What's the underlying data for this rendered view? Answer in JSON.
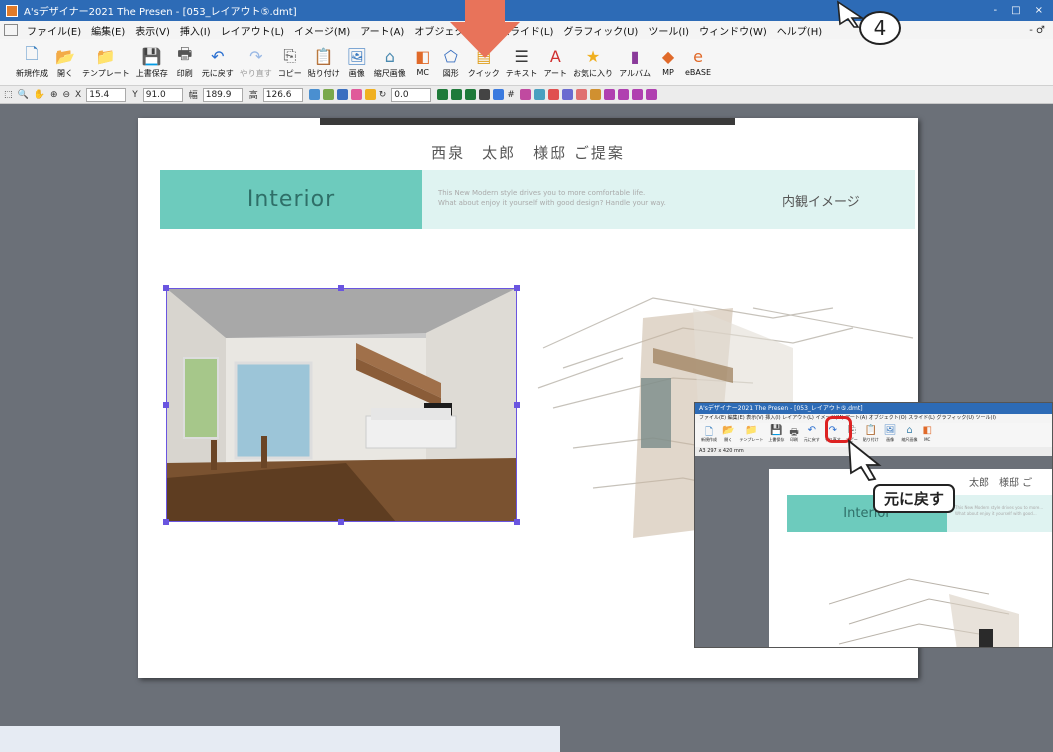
{
  "window": {
    "title": "A'sデザイナー2021 The Presen - [053_レイアウト⑤.dmt]",
    "controls": [
      "-",
      "□",
      "×"
    ]
  },
  "menu": {
    "items": [
      "ファイル(E)",
      "編集(E)",
      "表示(V)",
      "挿入(I)",
      "レイアウト(L)",
      "イメージ(M)",
      "アート(A)",
      "オブジェクト(O)",
      "スライド(L)",
      "グラフィック(U)",
      "ツール(I)",
      "ウィンドウ(W)",
      "ヘルプ(H)"
    ],
    "mdi": "- ♂"
  },
  "toolbar": {
    "buttons": [
      {
        "label": "新規作成",
        "icon": "new-doc-icon",
        "glyph": "🗋",
        "disabled": false
      },
      {
        "label": "開く",
        "icon": "open-folder-icon",
        "glyph": "📂",
        "disabled": false
      },
      {
        "label": "テンプレート",
        "icon": "template-icon",
        "glyph": "📁",
        "disabled": false
      },
      {
        "label": "上書保存",
        "icon": "save-icon",
        "glyph": "💾",
        "disabled": false
      },
      {
        "label": "印刷",
        "icon": "print-icon",
        "glyph": "🖶",
        "disabled": false
      },
      {
        "label": "元に戻す",
        "icon": "undo-icon",
        "glyph": "↶",
        "disabled": false
      },
      {
        "label": "やり直す",
        "icon": "redo-icon",
        "glyph": "↷",
        "disabled": true
      },
      {
        "label": "コピー",
        "icon": "copy-icon",
        "glyph": "⎘",
        "disabled": false
      },
      {
        "label": "貼り付け",
        "icon": "paste-icon",
        "glyph": "📋",
        "disabled": false
      },
      {
        "label": "画像",
        "icon": "image-icon",
        "glyph": "🖼",
        "disabled": false
      },
      {
        "label": "縮尺画像",
        "icon": "scaled-image-icon",
        "glyph": "⌂",
        "disabled": false
      },
      {
        "label": "MC",
        "icon": "mc-icon",
        "glyph": "◧",
        "disabled": false
      },
      {
        "label": "図形",
        "icon": "shape-icon",
        "glyph": "⬠",
        "disabled": false
      },
      {
        "label": "クイック",
        "icon": "quick-icon",
        "glyph": "▤",
        "disabled": false
      },
      {
        "label": "テキスト",
        "icon": "text-icon",
        "glyph": "☰",
        "disabled": false
      },
      {
        "label": "アート",
        "icon": "art-icon",
        "glyph": "A",
        "disabled": false
      },
      {
        "label": "お気に入り",
        "icon": "favorite-star-icon",
        "glyph": "★",
        "disabled": false
      },
      {
        "label": "アルバム",
        "icon": "album-icon",
        "glyph": "▮",
        "disabled": false
      },
      {
        "label": "MP",
        "icon": "mp-icon",
        "glyph": "◆",
        "disabled": false
      },
      {
        "label": "eBASE",
        "icon": "ebase-icon",
        "glyph": "e",
        "disabled": false
      }
    ]
  },
  "toolbar2": {
    "x_label": "X",
    "x_value": "15.4",
    "y_label": "Y",
    "y_value": "91.0",
    "w_label": "幅",
    "w_value": "189.9",
    "h_label": "高",
    "h_value": "126.6",
    "rot_value": "0.0"
  },
  "page": {
    "title": "西泉　太郎　様邸  ご提案",
    "section": "Interior",
    "tagline1": "This New Modern style drives you to more comfortable life.",
    "tagline2": "What about enjoy it yourself with good design? Handle your way.",
    "right_label": "内観イメージ"
  },
  "callouts": {
    "step": "4",
    "undo": "元に戻す"
  },
  "inset": {
    "title": "A'sデザイナー2021 The Presen - [053_レイアウト⑤.dmt]",
    "menu": "ファイル(E)  編集(E)  表示(V)  挿入(I)  レイアウト(L)  イメージ(M)  アート(A)  オブジェクト(O)  スライド(L)  グラフィック(U)  ツール(I)",
    "paper": "A3 297 x 420 mm",
    "section": "Interior",
    "name": "太郎　様邸  ご",
    "tagline1": "This New Modern style drives you to more...",
    "tagline2": "What about enjoy it yourself with good..."
  },
  "colors": {
    "accent_teal": "#6dcbbd",
    "band_light": "#dff3f1",
    "titlebar": "#2d6bb6",
    "arrow": "#e8735a",
    "selection": "#6a55e0",
    "undo_ring": "#dd2222"
  }
}
